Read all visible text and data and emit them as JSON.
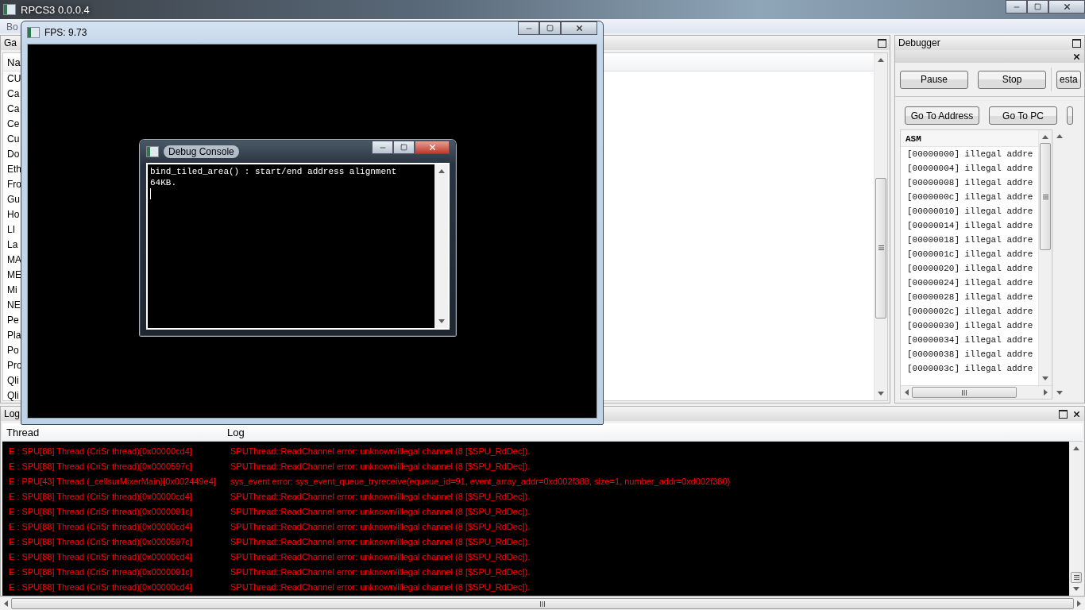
{
  "main_window": {
    "title": "RPCS3 0.0.0.4",
    "menu": [
      "Bo"
    ]
  },
  "game_list": {
    "title": "Ga",
    "column": "Na",
    "items": [
      "CU",
      "Ca",
      "Ca",
      "Ce",
      "Cu",
      "Do",
      "Eth",
      "Fro",
      "Gu",
      "Ho",
      "LI",
      "La",
      "MA",
      "ME",
      "Mi",
      "NE",
      "Pe",
      "Pla",
      "Po",
      "Pro",
      "Qli",
      "Qli"
    ]
  },
  "debugger": {
    "title": "Debugger",
    "toolbar": [
      "Pause",
      "Stop",
      "esta"
    ],
    "nav_buttons": [
      "Go To Address",
      "Go To PC"
    ],
    "asm": {
      "header": "ASM",
      "rows": [
        "[00000000] illegal addre",
        "[00000004] illegal addre",
        "[00000008] illegal addre",
        "[0000000c] illegal addre",
        "[00000010] illegal addre",
        "[00000014] illegal addre",
        "[00000018] illegal addre",
        "[0000001c] illegal addre",
        "[00000020] illegal addre",
        "[00000024] illegal addre",
        "[00000028] illegal addre",
        "[0000002c] illegal addre",
        "[00000030] illegal addre",
        "[00000034] illegal addre",
        "[00000038] illegal addre",
        "[0000003c] illegal addre"
      ]
    }
  },
  "log": {
    "title": "Log",
    "columns": [
      "Thread",
      "Log"
    ],
    "rows": [
      {
        "thread": "E : SPU[88] Thread (CriSr thread)[0x00000cd4]",
        "message": "SPUThread::ReadChannel error: unknown/illegal channel (8 [$SPU_RdDec])."
      },
      {
        "thread": "E : SPU[88] Thread (CriSr thread)[0x0000597c]",
        "message": "SPUThread::ReadChannel error: unknown/illegal channel (8 [$SPU_RdDec])."
      },
      {
        "thread": "E : PPU[43] Thread (_cellsurMixerMain)[0x002449e4]",
        "message": "sys_event error: sys_event_queue_tryreceive(equeue_id=91, event_array_addr=0xd002f388, size=1, number_addr=0xd002f380)"
      },
      {
        "thread": "E : SPU[88] Thread (CriSr thread)[0x00000cd4]",
        "message": "SPUThread::ReadChannel error: unknown/illegal channel (8 [$SPU_RdDec])."
      },
      {
        "thread": "E : SPU[88] Thread (CriSr thread)[0x0000091c]",
        "message": "SPUThread::ReadChannel error: unknown/illegal channel (8 [$SPU_RdDec])."
      },
      {
        "thread": "E : SPU[88] Thread (CriSr thread)[0x00000cd4]",
        "message": "SPUThread::ReadChannel error: unknown/illegal channel (8 [$SPU_RdDec])."
      },
      {
        "thread": "E : SPU[88] Thread (CriSr thread)[0x0000597c]",
        "message": "SPUThread::ReadChannel error: unknown/illegal channel (8 [$SPU_RdDec])."
      },
      {
        "thread": "E : SPU[88] Thread (CriSr thread)[0x00000cd4]",
        "message": "SPUThread::ReadChannel error: unknown/illegal channel (8 [$SPU_RdDec])."
      },
      {
        "thread": "E : SPU[88] Thread (CriSr thread)[0x0000091c]",
        "message": "SPUThread::ReadChannel error: unknown/illegal channel (8 [$SPU_RdDec])."
      },
      {
        "thread": "E : SPU[88] Thread (CriSr thread)[0x00000cd4]",
        "message": "SPUThread::ReadChannel error: unknown/illegal channel (8 [$SPU_RdDec])."
      }
    ]
  },
  "fps_window": {
    "title": "FPS: 9.73"
  },
  "debug_console": {
    "title": "Debug Console",
    "lines": [
      "bind_tiled_area() : start/end address alignment",
      "64KB."
    ]
  }
}
